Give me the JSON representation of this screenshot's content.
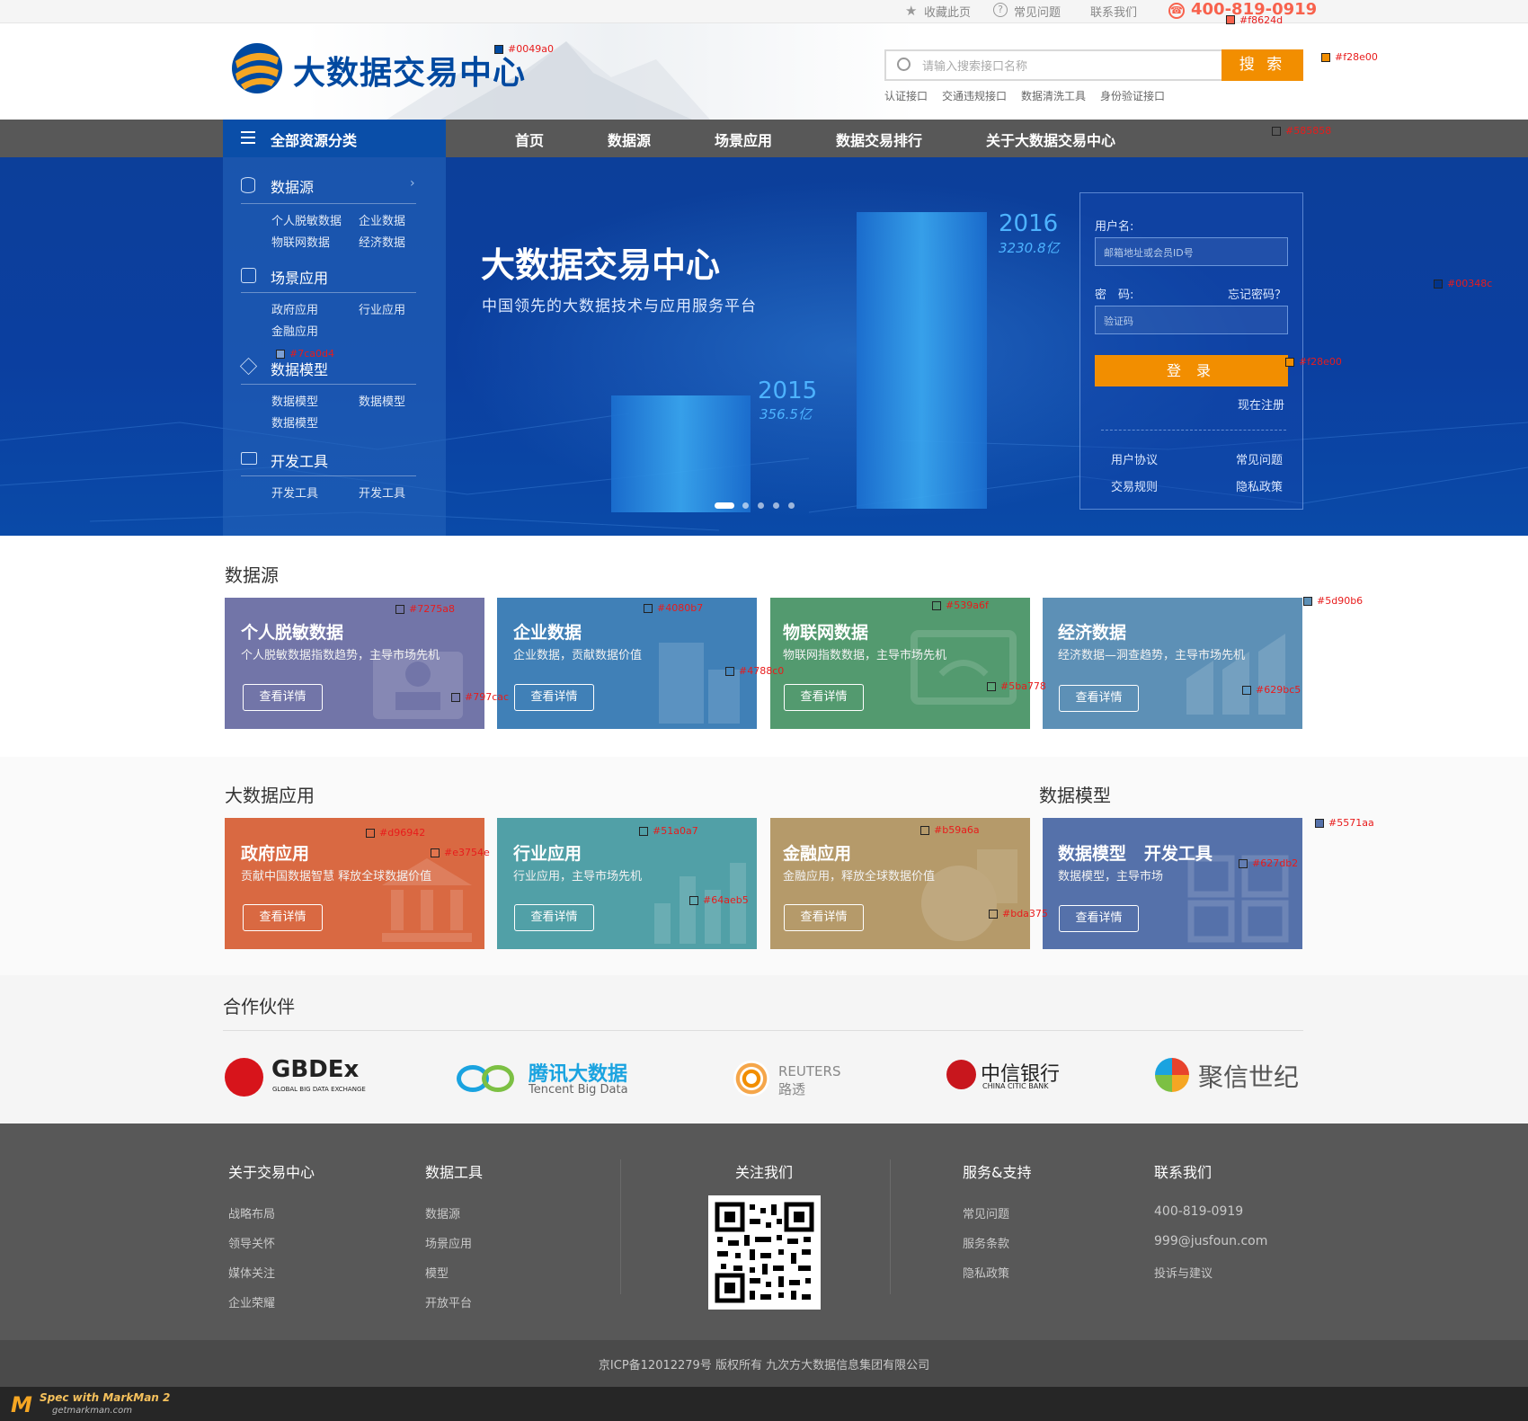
{
  "topbar": {
    "bookmark": "收藏此页",
    "faq": "常见问题",
    "contact": "联系我们",
    "phone": "400-819-0919"
  },
  "header": {
    "logo_text": "大数据交易中心",
    "search_placeholder": "请输入搜索接口名称",
    "search_button": "搜 索",
    "hot_links": [
      "认证接口",
      "交通违规接口",
      "数据清洗工具",
      "身份验证接口"
    ]
  },
  "nav": {
    "category_label": "全部资源分类",
    "items": [
      "首页",
      "数据源",
      "场景应用",
      "数据交易排行",
      "关于大数据交易中心"
    ]
  },
  "sidebar": {
    "groups": [
      {
        "title": "数据源",
        "items": [
          "个人脱敏数据",
          "企业数据",
          "物联网数据",
          "经济数据"
        ]
      },
      {
        "title": "场景应用",
        "items": [
          "政府应用",
          "行业应用",
          "金融应用"
        ]
      },
      {
        "title": "数据模型",
        "items": [
          "数据模型",
          "数据模型",
          "数据模型"
        ]
      },
      {
        "title": "开发工具",
        "items": [
          "开发工具",
          "开发工具"
        ]
      }
    ]
  },
  "hero": {
    "title": "大数据交易中心",
    "subtitle": "中国领先的大数据技术与应用服务平台",
    "year1": "2016",
    "value1": "3230.8亿",
    "year2": "2015",
    "value2": "356.5亿",
    "slide_count": 5,
    "active_slide": 1
  },
  "login": {
    "username_label": "用户名:",
    "username_placeholder": "邮箱地址或会员ID号",
    "password_label": "密　码:",
    "forgot": "忘记密码？",
    "password_placeholder": "验证码",
    "login_button": "登 录",
    "register": "现在注册",
    "links": [
      "用户协议",
      "常见问题",
      "交易规则",
      "隐私政策"
    ]
  },
  "data_sources": {
    "title": "数据源",
    "cards": [
      {
        "title": "个人脱敏数据",
        "desc": "个人脱敏数据指数趋势，主导市场先机",
        "button": "查看详情",
        "color": "#7275a8"
      },
      {
        "title": "企业数据",
        "desc": "企业数据，贡献数据价值",
        "button": "查看详情",
        "color": "#4080b7"
      },
      {
        "title": "物联网数据",
        "desc": "物联网指数数据，主导市场先机",
        "button": "查看详情",
        "color": "#539a6f"
      },
      {
        "title": "经济数据",
        "desc": "经济数据—洞查趋势，主导市场先机",
        "button": "查看详情",
        "color": "#5d90b6"
      }
    ]
  },
  "applications": {
    "title": "大数据应用",
    "model_title": "数据模型",
    "cards": [
      {
        "title": "政府应用",
        "desc": "贡献中国数据智慧 释放全球数据价值",
        "button": "查看详情",
        "color": "#d96942"
      },
      {
        "title": "行业应用",
        "desc": "行业应用，主导市场先机",
        "button": "查看详情",
        "color": "#51a0a7"
      },
      {
        "title": "金融应用",
        "desc": "金融应用，释放全球数据价值",
        "button": "查看详情",
        "color": "#b59a6a"
      },
      {
        "title": "数据模型   开发工具",
        "desc": "数据模型，主导市场",
        "button": "查看详情",
        "color": "#5571aa"
      }
    ]
  },
  "partners": {
    "title": "合作伙伴",
    "logos": [
      {
        "name": "GBDEx",
        "sub": "GLOBAL BIG DATA EXCHANGE"
      },
      {
        "name": "腾讯大数据",
        "sub": "Tencent Big Data"
      },
      {
        "name": "REUTERS",
        "sub": "路透"
      },
      {
        "name": "中信银行",
        "sub": "CHINA CITIC BANK"
      },
      {
        "name": "聚信世纪",
        "sub": ""
      }
    ]
  },
  "footer": {
    "col1": {
      "title": "关于交易中心",
      "links": [
        "战略布局",
        "领导关怀",
        "媒体关注",
        "企业荣耀"
      ]
    },
    "col2": {
      "title": "数据工具",
      "links": [
        "数据源",
        "场景应用",
        "模型",
        "开放平台"
      ]
    },
    "col3": {
      "title": "关注我们"
    },
    "col4": {
      "title": "服务&支持",
      "links": [
        "常见问题",
        "服务条款",
        "隐私政策"
      ]
    },
    "col5": {
      "title": "联系我们",
      "links": [
        "400-819-0919",
        "999@jusfoun.com",
        "投诉与建议"
      ]
    },
    "copyright": "京ICP备12012279号 版权所有 九次方大数据信息集团有限公司"
  },
  "markman": {
    "brand": "Spec with MarkMan 2",
    "url": "getmarkman.com"
  },
  "swatches": [
    "#0049a0",
    "#f8624d",
    "#f28e00",
    "#585858",
    "#00348c",
    "#f28e00",
    "#7ca0d4",
    "#7275a8",
    "#797cac",
    "#4080b7",
    "#4788c0",
    "#539a6f",
    "#5ba778",
    "#5d90b6",
    "#629bc5",
    "#d96942",
    "#e3754e",
    "#51a0a7",
    "#64aeb5",
    "#b59a6a",
    "#bda375",
    "#5571aa",
    "#627db2"
  ]
}
